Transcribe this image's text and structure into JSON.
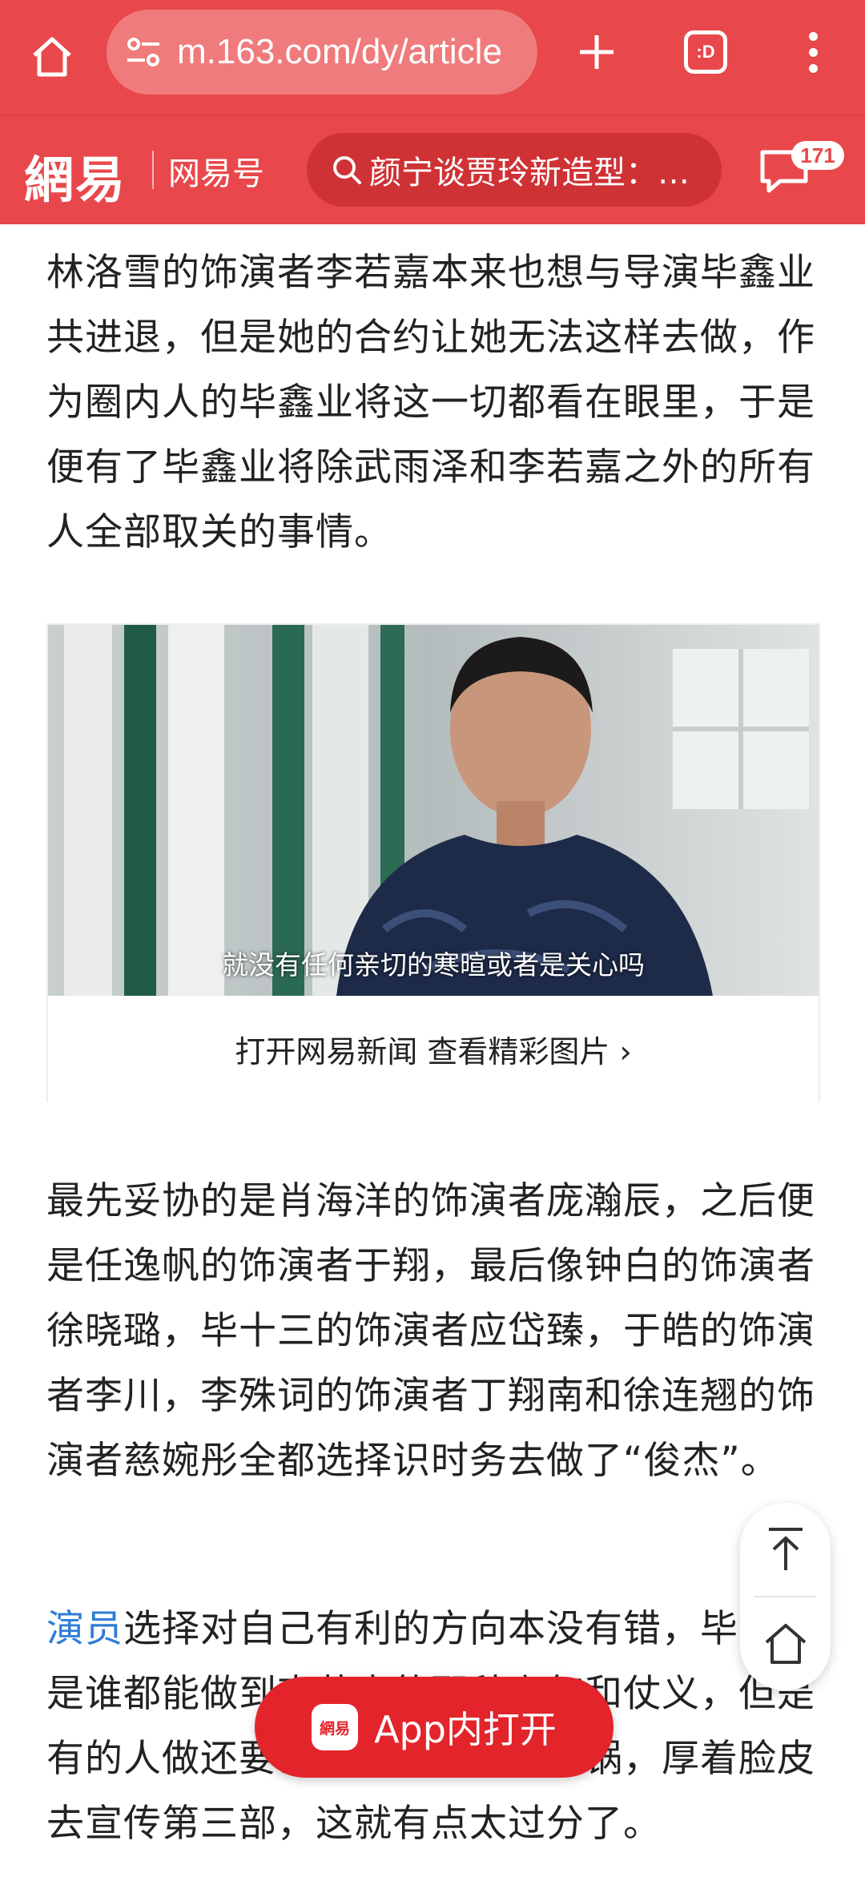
{
  "browser": {
    "url": "m.163.com/dy/article",
    "tab_count_label": ":D"
  },
  "site_header": {
    "logo_text": "網易",
    "section_label": "网易号",
    "search_text": "颜宁谈贾玲新造型：…",
    "message_count": "171"
  },
  "article": {
    "paragraph_1": "林洛雪的饰演者李若嘉本来也想与导演毕鑫业共进退，但是她的合约让她无法这样去做，作为圈内人的毕鑫业将这一切都看在眼里，于是便有了毕鑫业将除武雨泽和李若嘉之外的所有人全部取关的事情。",
    "image_subtitle": "就没有任何亲切的寒暄或者是关心吗",
    "image_caption": "打开网易新闻 查看精彩图片 ›",
    "paragraph_2": "最先妥协的是肖海洋的饰演者庞瀚辰，之后便是任逸帆的饰演者于翔，最后像钟白的饰演者徐晓璐，毕十三的饰演者应岱臻，于皓的饰演者李川，李殊词的饰演者丁翔南和徐连翘的饰演者慈婉彤全都选择识时务去做了“俊杰”。",
    "paragraph_3_link": "演员",
    "paragraph_3": "选择对自己有利的方向本没有错，毕竟不是谁都能做到李若嘉的那种义气和仗义，但是有的人做还要去武雨泽家里吃火锅，厚着脸皮去宣传第三部，这就有点太过分了。"
  },
  "open_app": {
    "logo_text": "網易",
    "label": "App内打开"
  },
  "colors": {
    "brand_red": "#e8484b",
    "button_red": "#e3242b",
    "link_blue": "#2d7cd6"
  }
}
